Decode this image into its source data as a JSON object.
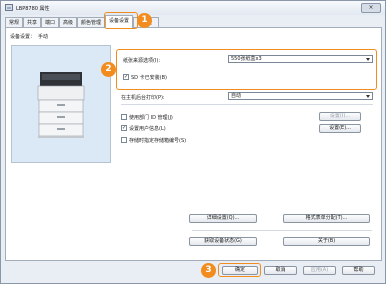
{
  "window": {
    "title": "LBP8780 属性",
    "close_glyph": "×"
  },
  "tabs": [
    "常规",
    "共享",
    "端口",
    "高级",
    "颜色管理",
    "设备设置",
    "配置文件"
  ],
  "panel": {
    "device_settings_label": "设备设置：",
    "device_settings_value": "手动",
    "paper_source_label": "纸张来源选项(I):",
    "paper_source_value": "550张纸盒x3",
    "sd_card_label": "SD 卡已安装(B)",
    "host_spool_label": "在主机后台打印(P):",
    "host_spool_value": "自动",
    "dept_id_label": "使用部门 ID 管理(J)",
    "user_info_label": "设置用户信息(L)",
    "store_job_label": "存储时指定存储箱编号(S)",
    "settings_btn_1": "设置(I)...",
    "settings_btn_2": "设置(E)...",
    "detail_settings_btn": "详细设置(Q)...",
    "format_form_btn": "格式表单分配(T)...",
    "get_status_btn": "获取设备状态(G)",
    "about_btn": "关于(B)"
  },
  "footer": {
    "ok": "确定",
    "cancel": "取消",
    "apply": "应用(A)",
    "help": "帮助"
  },
  "callouts": [
    "1",
    "2",
    "3"
  ],
  "colors": {
    "accent": "#f28c1e",
    "preview_bg": "#dbe8f6"
  }
}
